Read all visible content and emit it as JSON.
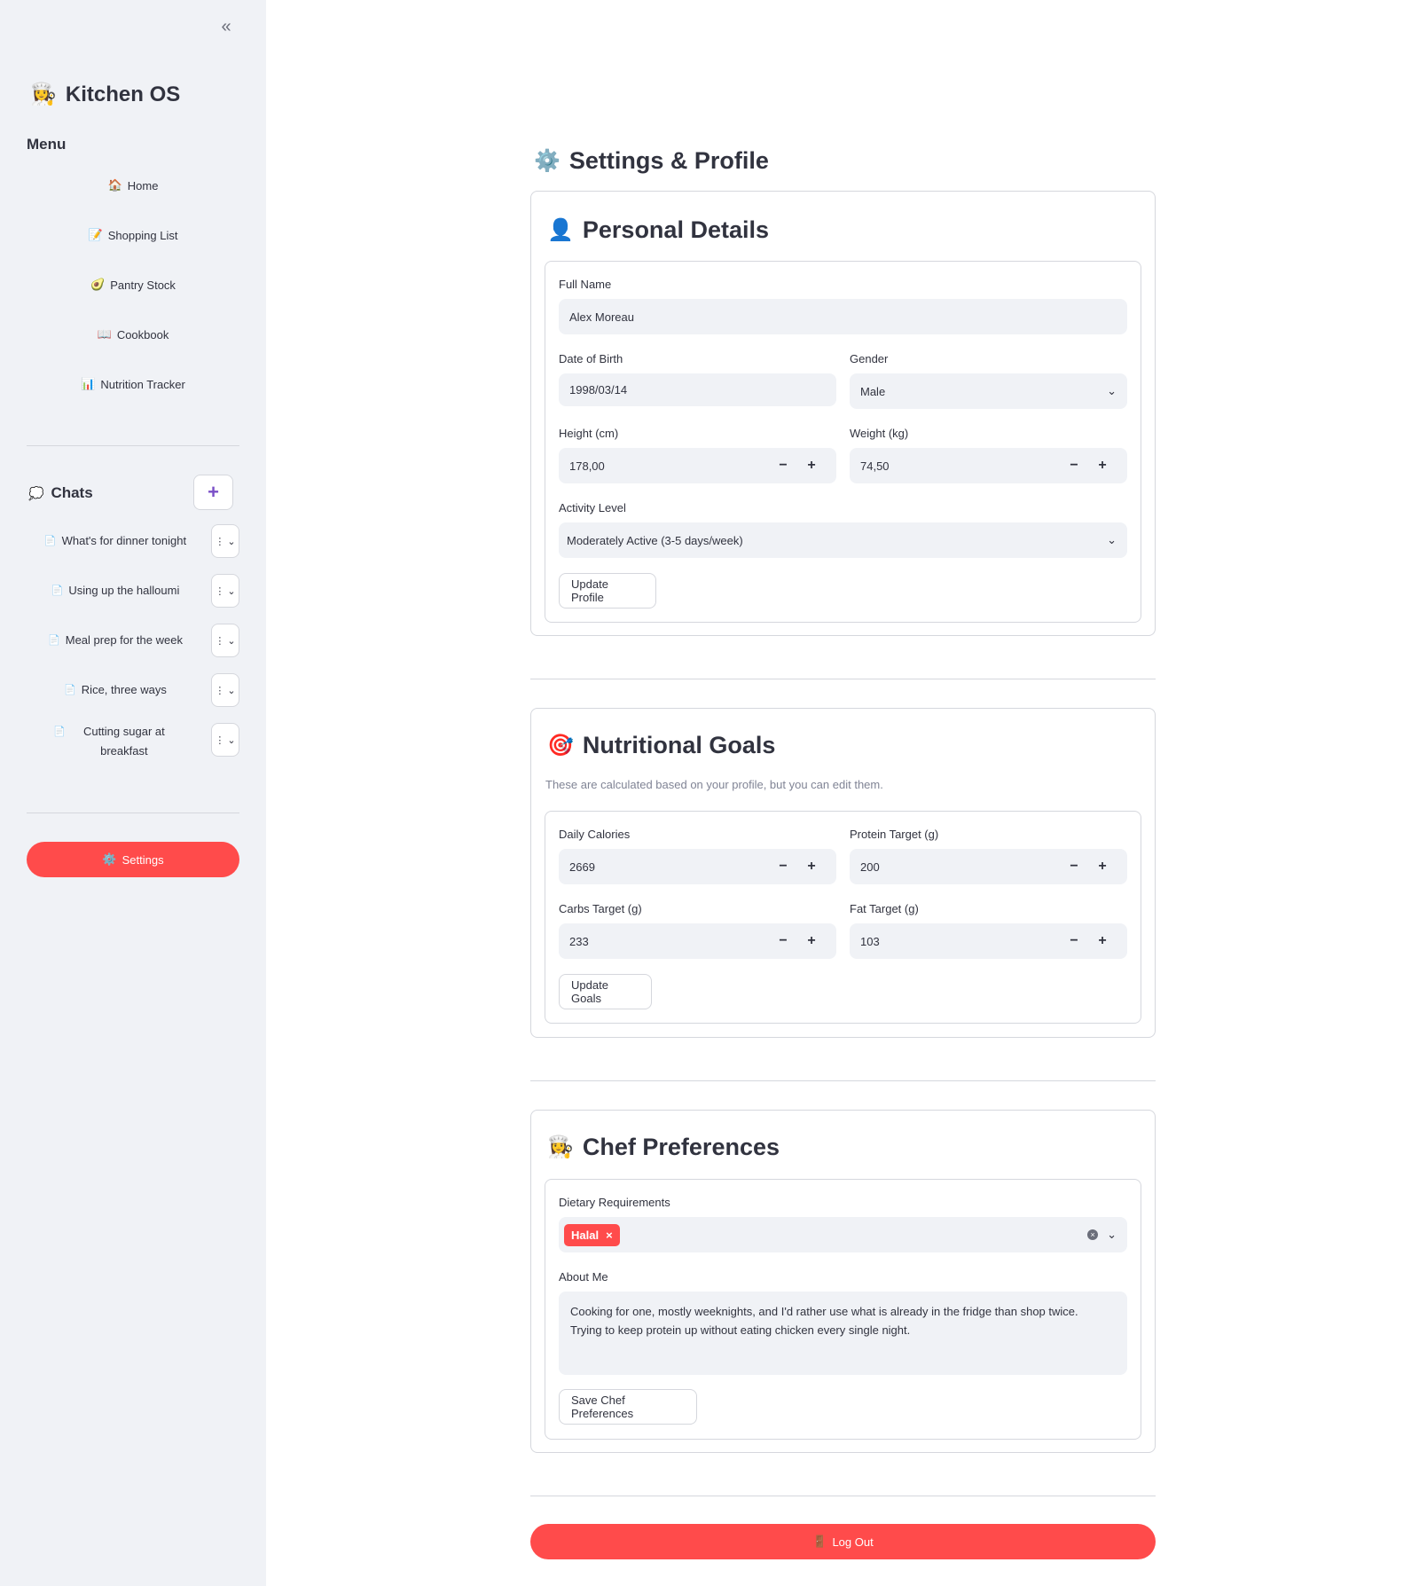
{
  "sidebar": {
    "collapse_icon": "«",
    "brand": {
      "emoji": "👩‍🍳",
      "title": "Kitchen OS"
    },
    "menu_heading": "Menu",
    "nav": [
      {
        "icon": "🏠",
        "label": "Home"
      },
      {
        "icon": "📝",
        "label": "Shopping List"
      },
      {
        "icon": "🥑",
        "label": "Pantry Stock"
      },
      {
        "icon": "📖",
        "label": "Cookbook"
      },
      {
        "icon": "📊",
        "label": "Nutrition Tracker"
      }
    ],
    "chats_heading": {
      "icon": "💭",
      "label": "Chats"
    },
    "new_chat_icon": "+",
    "chats": [
      {
        "icon": "📄",
        "label": "What's for dinner tonight"
      },
      {
        "icon": "📄",
        "label": "Using up the halloumi"
      },
      {
        "icon": "📄",
        "label": "Meal prep for the week"
      },
      {
        "icon": "📄",
        "label": "Rice, three ways"
      },
      {
        "icon": "📄",
        "label": "Cutting sugar at breakfast"
      }
    ],
    "chat_menu_icon": "⋮",
    "chat_menu_chevron": "⌄",
    "settings": {
      "icon": "⚙️",
      "label": "Settings"
    }
  },
  "page": {
    "title": {
      "emoji": "⚙️",
      "text": "Settings & Profile"
    }
  },
  "personal": {
    "title": {
      "emoji": "👤",
      "text": "Personal Details"
    },
    "full_name_label": "Full Name",
    "full_name": "Alex Moreau",
    "dob_label": "Date of Birth",
    "dob": "1998/03/14",
    "gender_label": "Gender",
    "gender": "Male",
    "height_label": "Height (cm)",
    "height": "178,00",
    "weight_label": "Weight (kg)",
    "weight": "74,50",
    "activity_label": "Activity Level",
    "activity": "Moderately Active (3-5 days/week)",
    "update_button": "Update Profile"
  },
  "goals": {
    "title": {
      "emoji": "🎯",
      "text": "Nutritional Goals"
    },
    "hint": "These are calculated based on your profile, but you can edit them.",
    "calories_label": "Daily Calories",
    "calories": "2669",
    "protein_label": "Protein Target (g)",
    "protein": "200",
    "carbs_label": "Carbs Target (g)",
    "carbs": "233",
    "fat_label": "Fat Target (g)",
    "fat": "103",
    "update_button": "Update Goals"
  },
  "chef": {
    "title": {
      "emoji": "👩‍🍳",
      "text": "Chef Preferences"
    },
    "dietary_label": "Dietary Requirements",
    "dietary_tags": [
      "Halal"
    ],
    "about_label": "About Me",
    "about_line1": "Cooking for one, mostly weeknights, and I'd rather use what is already in the fridge than shop twice.",
    "about_line2": "Trying to keep protein up without eating chicken every single night.",
    "save_button": "Save Chef Preferences"
  },
  "logout": {
    "icon": "🚪",
    "label": "Log Out"
  },
  "colors": {
    "accent": "#ff4b4b",
    "sidebar_bg": "#f0f2f6",
    "field_bg": "#f0f2f6",
    "border": "#d5d7dd"
  }
}
